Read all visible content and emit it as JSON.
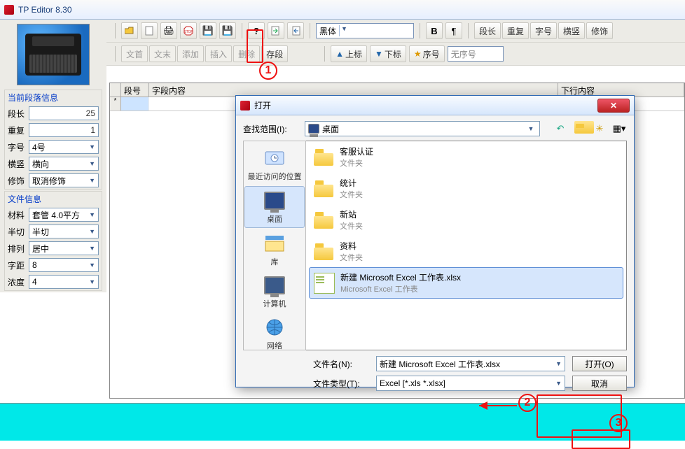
{
  "app": {
    "title": "TP Editor  8.30"
  },
  "toolbar1": {
    "font_select": "黑体",
    "btns_right": [
      "段长",
      "重复",
      "字号",
      "横竖",
      "修饰"
    ]
  },
  "toolbar2": {
    "left_btns": [
      "文首",
      "文末",
      "添加",
      "插入",
      "删除",
      "存段"
    ],
    "marker_btns": {
      "up": "上标",
      "down": "下标",
      "star": "序号"
    },
    "seq_input": "无序号"
  },
  "grid": {
    "headers": [
      "段号",
      "字段内容",
      "下行内容"
    ],
    "row_marker": "*"
  },
  "panel_para": {
    "title": "当前段落信息",
    "rows": [
      {
        "label": "段长",
        "value": "25",
        "type": "num"
      },
      {
        "label": "重复",
        "value": "1",
        "type": "num"
      },
      {
        "label": "字号",
        "value": "4号",
        "type": "sel"
      },
      {
        "label": "横竖",
        "value": "横向",
        "type": "sel"
      },
      {
        "label": "修饰",
        "value": "取消修饰",
        "type": "sel"
      }
    ]
  },
  "panel_file": {
    "title": "文件信息",
    "rows": [
      {
        "label": "材料",
        "value": "套管 4.0平方",
        "type": "sel"
      },
      {
        "label": "半切",
        "value": "半切",
        "type": "sel"
      },
      {
        "label": "排列",
        "value": "居中",
        "type": "sel"
      },
      {
        "label": "字距",
        "value": "8",
        "type": "sel"
      },
      {
        "label": "浓度",
        "value": "4",
        "type": "sel"
      }
    ]
  },
  "dialog": {
    "title": "打开",
    "lookin_label": "查找范围(I):",
    "lookin_value": "桌面",
    "places": [
      {
        "name": "最近访问的位置",
        "icon": "recent"
      },
      {
        "name": "桌面",
        "icon": "desktop",
        "selected": true
      },
      {
        "name": "库",
        "icon": "library"
      },
      {
        "name": "计算机",
        "icon": "computer"
      },
      {
        "name": "网络",
        "icon": "network"
      }
    ],
    "files": [
      {
        "name": "客服认证",
        "type": "文件夹",
        "kind": "folder"
      },
      {
        "name": "统计",
        "type": "文件夹",
        "kind": "folder"
      },
      {
        "name": "新站",
        "type": "文件夹",
        "kind": "folder"
      },
      {
        "name": "资料",
        "type": "文件夹",
        "kind": "folder"
      },
      {
        "name": "新建 Microsoft Excel 工作表.xlsx",
        "type": "Microsoft Excel 工作表",
        "kind": "excel",
        "selected": true
      }
    ],
    "filename_label": "文件名(N):",
    "filename_value": "新建 Microsoft Excel 工作表.xlsx",
    "filetype_label": "文件类型(T):",
    "filetype_value": "Excel  [*.xls *.xlsx]",
    "open_btn": "打开(O)",
    "cancel_btn": "取消"
  },
  "annotations": {
    "c1": "1",
    "c2": "2",
    "c3": "3"
  }
}
